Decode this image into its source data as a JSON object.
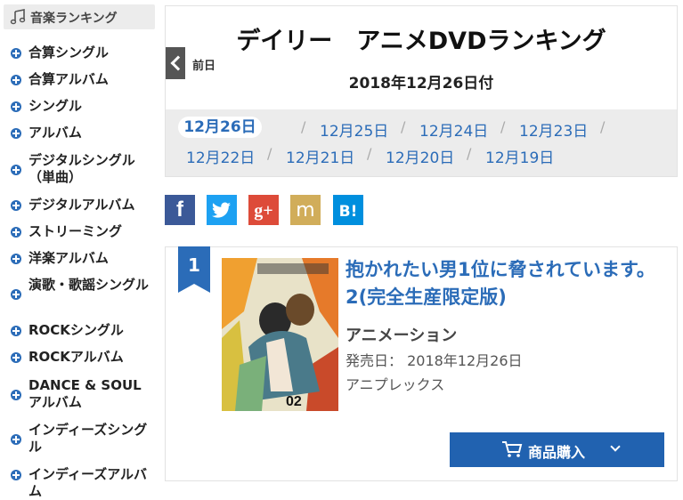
{
  "sidebar": {
    "title": "音楽ランキング",
    "items": [
      {
        "label": "合算シングル"
      },
      {
        "label": "合算アルバム"
      },
      {
        "label": "シングル"
      },
      {
        "label": "アルバム"
      },
      {
        "label": "デジタルシングル（単曲）"
      },
      {
        "label": "デジタルアルバム"
      },
      {
        "label": "ストリーミング"
      },
      {
        "label": "洋楽アルバム"
      },
      {
        "label": "演歌・歌謡シングル"
      },
      {
        "label": "ROCKシングル"
      },
      {
        "label": "ROCKアルバム"
      },
      {
        "label": "DANCE & SOULアルバム"
      },
      {
        "label": "インディーズシングル"
      },
      {
        "label": "インディーズアルバム"
      }
    ]
  },
  "header": {
    "title": "デイリー　アニメDVDランキング",
    "date": "2018年12月26日付",
    "prev_label": "前日",
    "dates": [
      "12月26日",
      "12月25日",
      "12月24日",
      "12月23日",
      "12月22日",
      "12月21日",
      "12月20日",
      "12月19日"
    ],
    "active_date_index": 0
  },
  "share": {
    "buttons": [
      {
        "icon": "facebook-icon",
        "glyph": "f",
        "color": "#3b5998"
      },
      {
        "icon": "twitter-icon",
        "glyph": "",
        "color": "#1da1f2"
      },
      {
        "icon": "google-plus-icon",
        "glyph": "g+",
        "color": "#dd4b39"
      },
      {
        "icon": "mixi-icon",
        "glyph": "m",
        "color": "#d1ad5a"
      },
      {
        "icon": "hatena-bookmark-icon",
        "glyph": "B!",
        "color": "#008fde"
      }
    ]
  },
  "ranking": {
    "rank": "1",
    "title": "抱かれたい男1位に脅されています。 2(完全生産限定版)",
    "category": "アニメーション",
    "release": "発売日： 2018年12月26日",
    "label": "アニプレックス",
    "buy_label": "商品購入",
    "cover_text": "02"
  },
  "colors": {
    "accent": "#2b6cb8",
    "buy": "#2162b0"
  }
}
